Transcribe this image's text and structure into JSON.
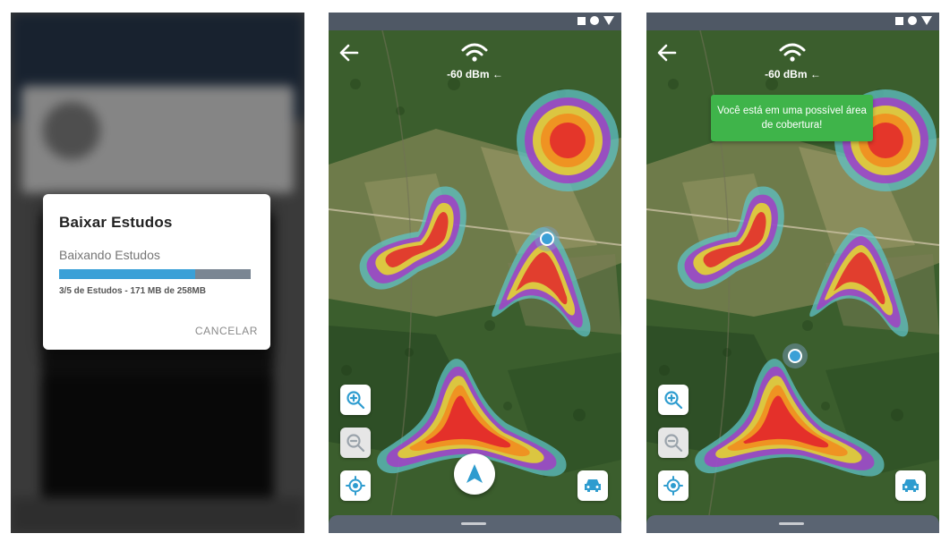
{
  "download_dialog": {
    "title": "Baixar Estudos",
    "message": "Baixando Estudos",
    "progress_fraction": 0.71,
    "progress_info": "3/5 de Estudos - 171 MB de 258MB",
    "cancel_label": "CANCELAR",
    "colors": {
      "progress_fill": "#3aa0d7",
      "progress_track": "#7a8693"
    }
  },
  "map_screen_1": {
    "signal": "-60 dBm ←",
    "icons": [
      "back-arrow-icon",
      "wifi-icon",
      "zoom-in-icon",
      "zoom-out-icon",
      "my-location-icon",
      "navigation-arrow-icon",
      "car-icon"
    ]
  },
  "map_screen_2": {
    "signal": "-60 dBm ←",
    "toast": "Você está em uma possível área de cobertura!",
    "colors": {
      "toast": "#3fb44a"
    }
  },
  "coverage_colors": [
    "#5fc2c6",
    "#a23ec4",
    "#e7dc2a",
    "#f28a1d",
    "#e2262b"
  ]
}
